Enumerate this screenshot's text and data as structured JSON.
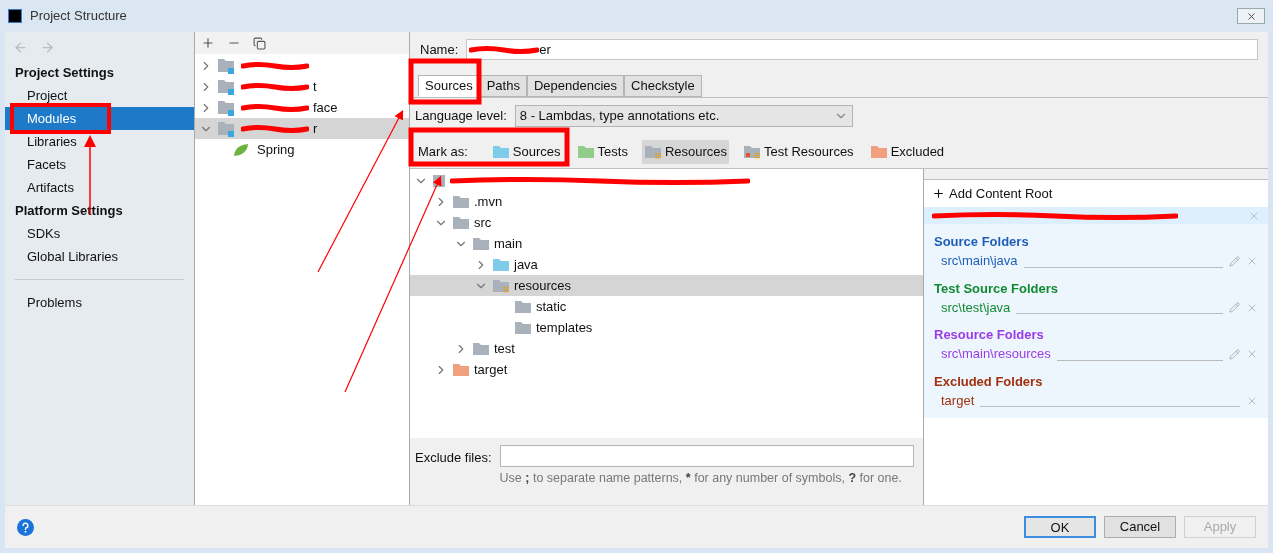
{
  "window": {
    "title": "Project Structure"
  },
  "sidebar": {
    "sections": [
      {
        "heading": "Project Settings",
        "items": [
          {
            "label": "Project",
            "selected": false
          },
          {
            "label": "Modules",
            "selected": true
          },
          {
            "label": "Libraries",
            "selected": false
          },
          {
            "label": "Facets",
            "selected": false
          },
          {
            "label": "Artifacts",
            "selected": false
          }
        ]
      },
      {
        "heading": "Platform Settings",
        "items": [
          {
            "label": "SDKs",
            "selected": false
          },
          {
            "label": "Global Libraries",
            "selected": false
          }
        ]
      }
    ],
    "footer_items": [
      {
        "label": "Problems",
        "selected": false
      }
    ]
  },
  "modules": [
    {
      "kind": "redacted",
      "expanded": false,
      "selected": false
    },
    {
      "kind": "redacted",
      "tail": "t",
      "expanded": false,
      "selected": false
    },
    {
      "kind": "redacted",
      "tail": "face",
      "expanded": false,
      "selected": false
    },
    {
      "kind": "redacted",
      "tail": "r",
      "expanded": true,
      "selected": true,
      "children": [
        {
          "kind": "facet",
          "label": "Spring",
          "selected": false
        }
      ]
    }
  ],
  "name_field": {
    "label": "Name:",
    "value_tail": "er"
  },
  "tabs": [
    {
      "label": "Sources",
      "selected": true
    },
    {
      "label": "Paths",
      "selected": false
    },
    {
      "label": "Dependencies",
      "selected": false
    },
    {
      "label": "Checkstyle",
      "selected": false
    }
  ],
  "language_level": {
    "label": "Language level:",
    "value": "8 - Lambdas, type annotations etc."
  },
  "mark_as": {
    "label": "Mark as:",
    "buttons": [
      {
        "label": "Sources",
        "kind": "sources",
        "selected": false
      },
      {
        "label": "Tests",
        "kind": "tests",
        "selected": false
      },
      {
        "label": "Resources",
        "kind": "resources",
        "selected": true
      },
      {
        "label": "Test Resources",
        "kind": "test_resources",
        "selected": false
      },
      {
        "label": "Excluded",
        "kind": "excluded",
        "selected": false
      }
    ]
  },
  "content_tree": {
    "kind": "redacted",
    "expanded": true,
    "selected": false,
    "children": [
      {
        "label": ".mvn",
        "kind": "folder",
        "expanded": false,
        "selected": false
      },
      {
        "label": "src",
        "kind": "folder",
        "expanded": true,
        "selected": false,
        "children": [
          {
            "label": "main",
            "kind": "folder",
            "expanded": true,
            "selected": false,
            "children": [
              {
                "label": "java",
                "kind": "sources",
                "expanded": false,
                "selected": false
              },
              {
                "label": "resources",
                "kind": "resources",
                "expanded": true,
                "selected": true,
                "children": [
                  {
                    "label": "static",
                    "kind": "folder",
                    "selected": false
                  },
                  {
                    "label": "templates",
                    "kind": "folder",
                    "selected": false
                  }
                ]
              }
            ]
          },
          {
            "label": "test",
            "kind": "folder",
            "expanded": false,
            "selected": false
          }
        ]
      },
      {
        "label": "target",
        "kind": "excluded",
        "expanded": false,
        "selected": false
      }
    ]
  },
  "exclude_files": {
    "label": "Exclude files:",
    "hint": [
      {
        "text": "Use ",
        "bold": false
      },
      {
        "text": ";",
        "bold": true
      },
      {
        "text": " to separate name patterns, ",
        "bold": false
      },
      {
        "text": "*",
        "bold": true
      },
      {
        "text": " for any number of symbols, ",
        "bold": false
      },
      {
        "text": "?",
        "bold": true
      },
      {
        "text": " for one.",
        "bold": false
      }
    ]
  },
  "roots_panel": {
    "add_label": "Add Content Root",
    "root": {
      "kind": "redacted"
    },
    "groups": [
      {
        "title": "Source Folders",
        "color": "#1d5fb8",
        "paths": [
          "src\\main\\java"
        ],
        "editable": true
      },
      {
        "title": "Test Source Folders",
        "color": "#128a32",
        "paths": [
          "src\\test\\java"
        ],
        "editable": true
      },
      {
        "title": "Resource Folders",
        "color": "#9a3ce8",
        "paths": [
          "src\\main\\resources"
        ],
        "editable": true
      },
      {
        "title": "Excluded Folders",
        "color": "#a0300e",
        "paths": [
          "target"
        ],
        "editable": false
      }
    ]
  },
  "buttons": [
    {
      "label": "OK",
      "kind": "default",
      "disabled": false
    },
    {
      "label": "Cancel",
      "kind": "normal",
      "disabled": false
    },
    {
      "label": "Apply",
      "kind": "normal",
      "disabled": true
    }
  ]
}
